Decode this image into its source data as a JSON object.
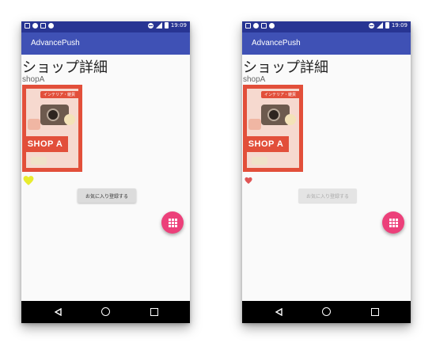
{
  "phones": [
    {
      "status_time": "19:09",
      "app_title": "AdvancePush",
      "page_title": "ショップ詳細",
      "shop_name": "shopA",
      "image_tag": "インテリア・雑貨",
      "image_label": "SHOP A",
      "heart_color": "#e8ec2e",
      "fav_button_label": "お気に入り登録する",
      "fav_button_state": "enabled"
    },
    {
      "status_time": "19:09",
      "app_title": "AdvancePush",
      "page_title": "ショップ詳細",
      "shop_name": "shopA",
      "image_tag": "インテリア・雑貨",
      "image_label": "SHOP A",
      "heart_color": "#e05555",
      "fav_button_label": "お気に入り登録する",
      "fav_button_state": "disabled"
    }
  ],
  "colors": {
    "status_bar": "#283593",
    "app_bar": "#3f51b5",
    "fab": "#ec407a",
    "shop_image_red": "#e24f3a"
  },
  "icons": {
    "fab": "grid-icon",
    "favorite": "heart-icon",
    "nav": [
      "back-icon",
      "home-icon",
      "recents-icon"
    ]
  }
}
